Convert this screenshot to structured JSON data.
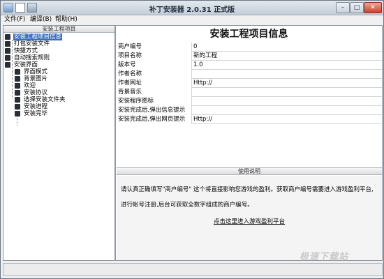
{
  "window": {
    "title": "补丁安装器 2.0.31 正式版"
  },
  "menu": [
    {
      "label": "文件(F)"
    },
    {
      "label": "编译(B)"
    },
    {
      "label": "帮助(H)"
    }
  ],
  "left_panel": {
    "header": "安装工程项目",
    "tree": [
      {
        "label": "安装工程项目信息",
        "selected": true
      },
      {
        "label": "打包安装文件"
      },
      {
        "label": "快捷方式"
      },
      {
        "label": "自动搜索规则"
      },
      {
        "label": "安装界面"
      },
      {
        "label": "界面模式"
      },
      {
        "label": "背景图片"
      },
      {
        "label": "欢迎"
      },
      {
        "label": "安装协议"
      },
      {
        "label": "选择安装文件夹"
      },
      {
        "label": "安装进程"
      },
      {
        "label": "安装完毕"
      }
    ]
  },
  "right_panel": {
    "title": "安装工程项目信息",
    "grid": [
      {
        "label": "商户编号",
        "value": "0"
      },
      {
        "label": "项目名称",
        "value": "新的工程"
      },
      {
        "label": "版本号",
        "value": "1.0"
      },
      {
        "label": "作者名称",
        "value": ""
      },
      {
        "label": "作者网址",
        "value": "Http://"
      },
      {
        "label": "背景音乐",
        "value": ""
      },
      {
        "label": "安装程序图标",
        "value": ""
      },
      {
        "label": "安装完成后,弹出信息提示",
        "value": ""
      },
      {
        "label": "安装完成后,弹出网页提示",
        "value": "Http://"
      }
    ]
  },
  "help": {
    "header": "使用说明",
    "line1": "请认真正确填写\"商户编号\" 这个将直接影响您游戏的盈利。获取商户编号需要进入游戏盈利平台,",
    "line2": "进行帐号注册,后台可获取全数字组成的商户编号。",
    "link": "点击这里进入游戏盈利平台",
    "watermark": "极速下载站"
  }
}
